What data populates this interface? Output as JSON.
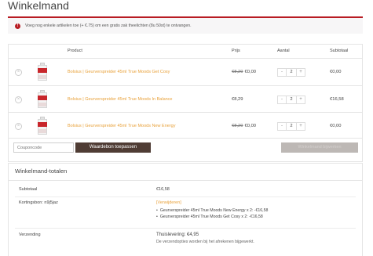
{
  "page": {
    "title": "Winkelmand"
  },
  "notice": {
    "icon": "exclamation-icon",
    "text": "Voeg nog enkele artikelen toe (+ €.75) om een gratis zak theelichten (8u 50st) te ontvangen.",
    "accent_color": "#b81c23"
  },
  "cart": {
    "headers": {
      "product": "Product",
      "price": "Prijs",
      "quantity": "Aantal",
      "subtotal": "Subtotaal"
    },
    "items": [
      {
        "name": "Bolsius | Geurverspreider 45ml True Moods Get Cosy",
        "price_old": "€8,29",
        "price": "€0,00",
        "qty": "2",
        "subtotal": "€0,00",
        "remove": "×",
        "minus": "-",
        "plus": "+"
      },
      {
        "name": "Bolsius | Geurverspreider 45ml True Moods In Balance",
        "price_old": "",
        "price": "€8,29",
        "qty": "2",
        "subtotal": "€16,58",
        "remove": "×",
        "minus": "-",
        "plus": "+"
      },
      {
        "name": "Bolsius | Geurverspreider 45ml True Moods New Energy",
        "price_old": "€8,29",
        "price": "€0,00",
        "qty": "2",
        "subtotal": "€0,00",
        "remove": "×",
        "minus": "-",
        "plus": "+"
      }
    ],
    "coupon_placeholder": "Couponcode",
    "apply_coupon_label": "Waardebon toepassen",
    "update_cart_label": "Winkelmand bijwerken"
  },
  "totals": {
    "title": "Winkelmand-totalen",
    "subtotal_label": "Subtotaal",
    "subtotal_value": "€16,58",
    "coupon_label": "Kortingsbon: n9j5jaz",
    "coupon_remove": "[Verwijderen]",
    "coupon_items": [
      "Geurverspreider 45ml True Moods New Energy x 2: -€16,58",
      "Geurverspreider 45ml True Moods Get Cosy x 2: -€16,58"
    ],
    "shipping_label": "Verzending",
    "shipping_value": "Thuislevering: €4,95",
    "shipping_note": "De verzendopties worden bij het afrekenen bijgewerkt."
  },
  "colors": {
    "link": "#e8a13a",
    "primary_button": "#4f3c34",
    "disabled_button": "#bdb8b5",
    "product_band": "#c8262b"
  }
}
